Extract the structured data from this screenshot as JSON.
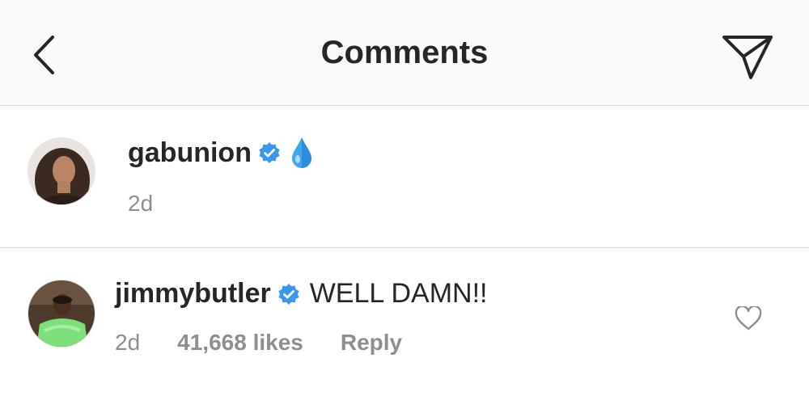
{
  "header": {
    "title": "Comments",
    "back_icon": "chevron-left-icon",
    "share_icon": "paper-plane-icon"
  },
  "comments": [
    {
      "username": "gabunion",
      "verified": true,
      "text": "💧",
      "time": "2d"
    },
    {
      "username": "jimmybutler",
      "verified": true,
      "text": "WELL DAMN!!",
      "time": "2d",
      "likes": "41,668 likes",
      "reply_label": "Reply"
    }
  ],
  "colors": {
    "verified": "#3897f0",
    "header_bg": "#fafafa",
    "divider": "#dbdbdb",
    "meta_text": "#8e8e8e",
    "droplet": "#3ea6f0"
  }
}
